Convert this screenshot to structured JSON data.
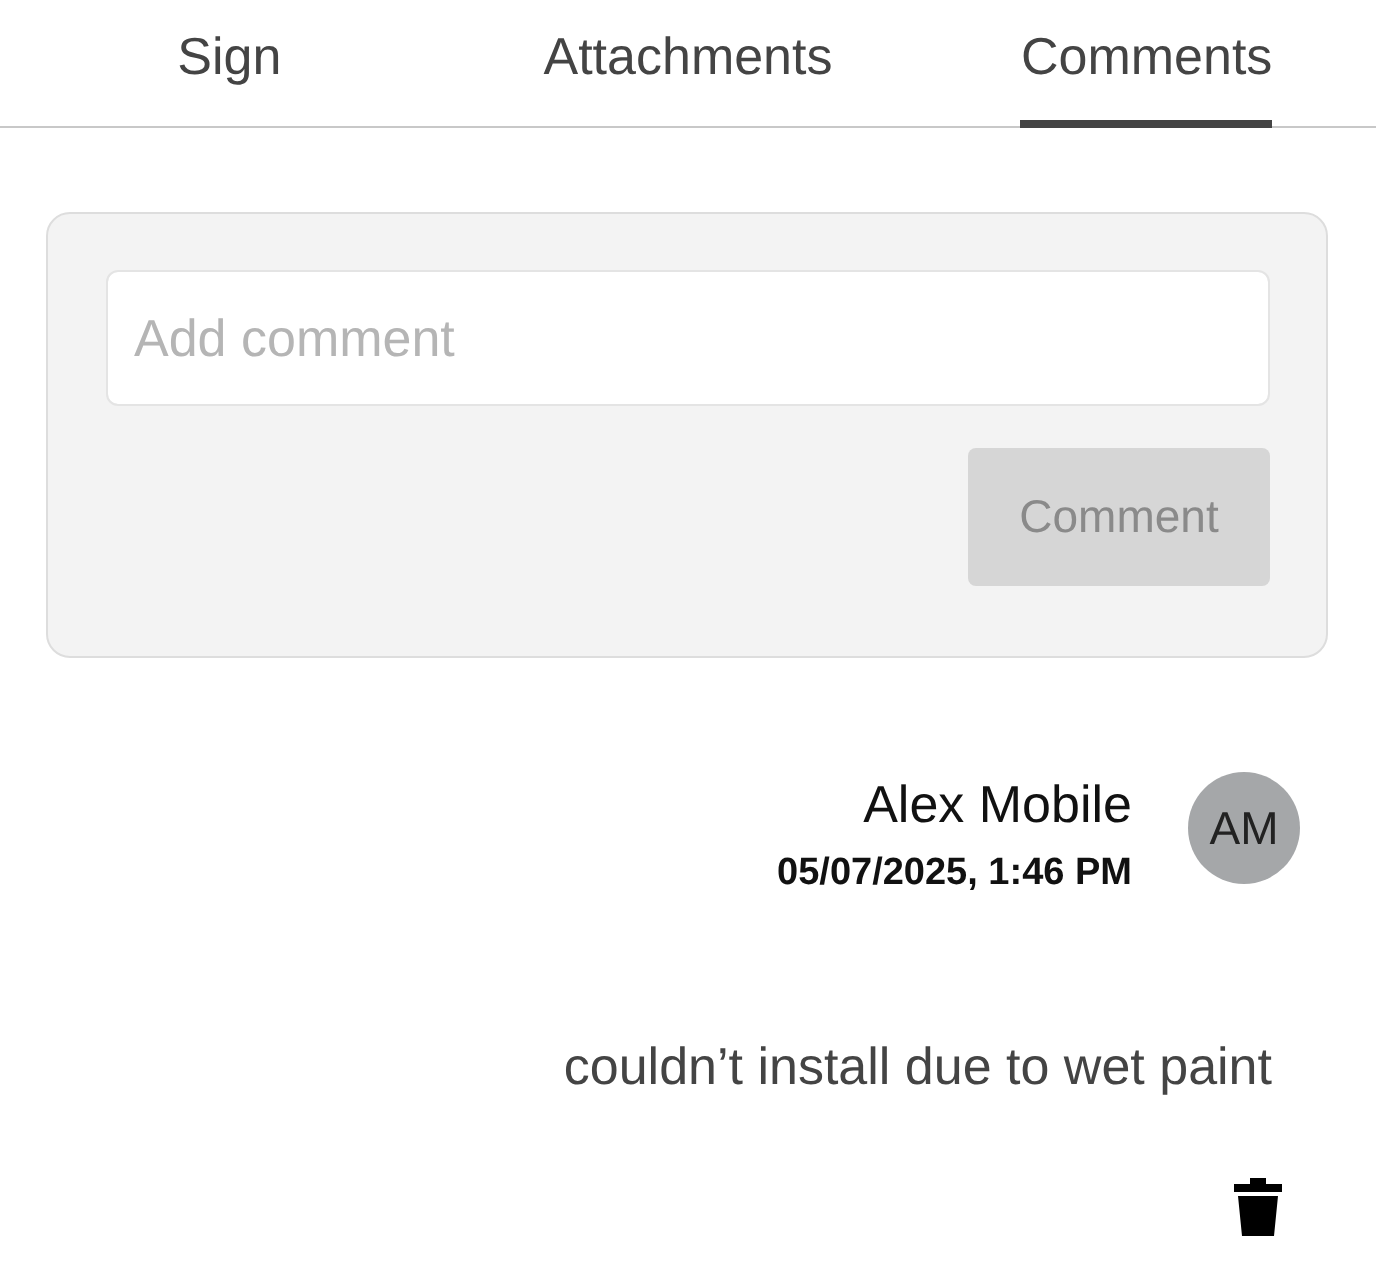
{
  "tabs": [
    {
      "label": "Sign",
      "selected": false
    },
    {
      "label": "Attachments",
      "selected": false
    },
    {
      "label": "Comments",
      "selected": true
    }
  ],
  "comment_form": {
    "placeholder": "Add comment",
    "button": {
      "label": "Comment",
      "disabled": true
    }
  },
  "comments": [
    {
      "author": "Alex Mobile",
      "timestamp": "05/07/2025, 1:46 PM",
      "initials": "AM",
      "text": "couldn’t install due to wet paint"
    }
  ]
}
